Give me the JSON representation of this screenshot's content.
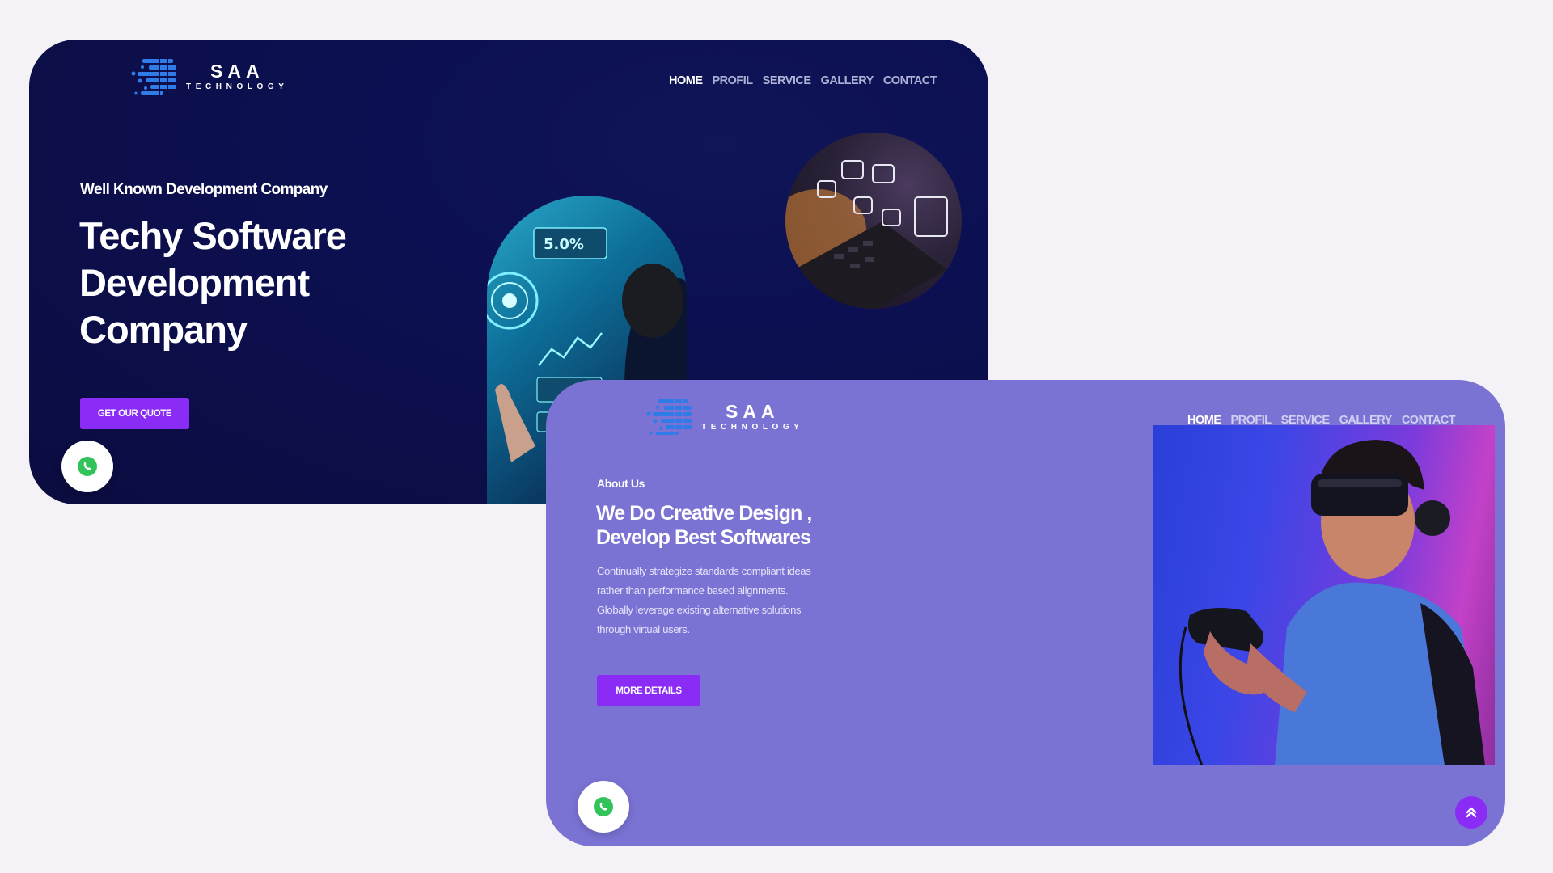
{
  "hero": {
    "logo": {
      "name": "SAA",
      "sub": "TECHNOLOGY"
    },
    "nav": [
      {
        "label": "HOME",
        "active": true
      },
      {
        "label": "PROFIL",
        "active": false
      },
      {
        "label": "SERVICE",
        "active": false
      },
      {
        "label": "GALLERY",
        "active": false
      },
      {
        "label": "CONTACT",
        "active": false
      }
    ],
    "tagline": "Well Known Development Company",
    "title_lines": [
      "Techy Software",
      "Development",
      "Company"
    ],
    "cta_label": "GET OUR QUOTE",
    "whatsapp_icon": "whatsapp-icon"
  },
  "about": {
    "logo": {
      "name": "SAA",
      "sub": "TECHNOLOGY"
    },
    "nav": [
      {
        "label": "HOME",
        "active": true
      },
      {
        "label": "PROFIL",
        "active": false
      },
      {
        "label": "SERVICE",
        "active": false
      },
      {
        "label": "GALLERY",
        "active": false
      },
      {
        "label": "CONTACT",
        "active": false
      }
    ],
    "eyebrow": "About Us",
    "title_lines": [
      "We Do Creative Design ,",
      "Develop Best Softwares"
    ],
    "body_lines": [
      "Continually strategize standards compliant ideas",
      "rather than performance based alignments.",
      "Globally leverage existing alternative solutions",
      "through virtual users."
    ],
    "cta_label": "MORE DETAILS",
    "whatsapp_icon": "whatsapp-icon",
    "scroll_top_icon": "double-chevron-up-icon"
  },
  "colors": {
    "hero_bg": "#0b0e48",
    "about_bg": "#7b73d4",
    "accent": "#8a2cf6",
    "logo_blue": "#2f7be8",
    "whatsapp_green": "#32c45a",
    "page_bg": "#f4f2f6"
  }
}
